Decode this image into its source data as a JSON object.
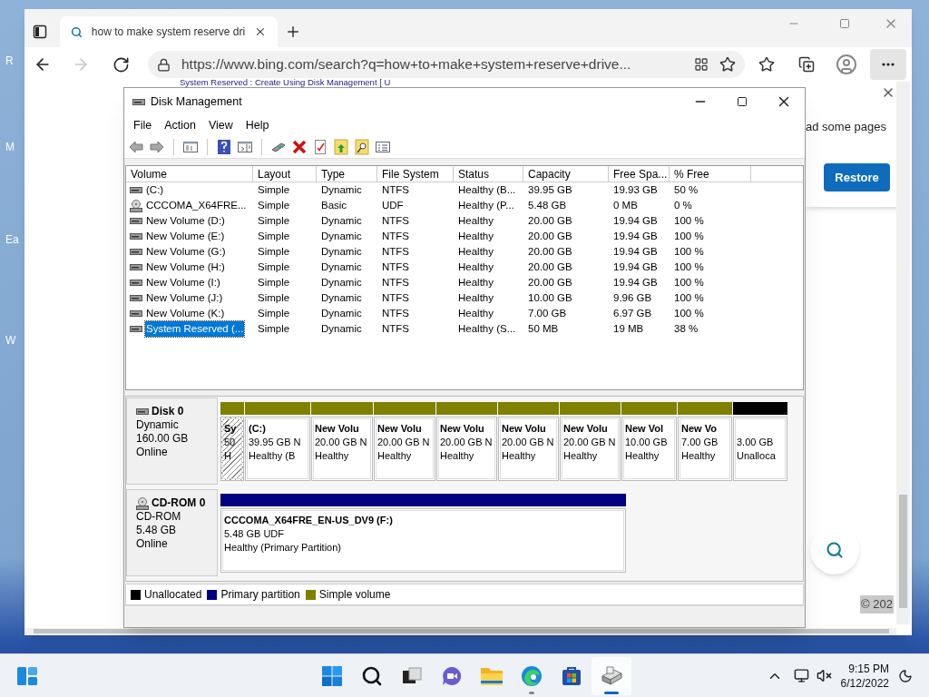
{
  "desktop": {
    "icon_labels": [
      "R",
      "M",
      "Ea",
      "W"
    ]
  },
  "browser": {
    "tab_title": "how to make system reserve dri",
    "address": "https://www.bing.com/search?q=how+to+make+system+reserve+drive...",
    "forward_disabled": true,
    "page": {
      "heading": "System Reserved : Create Using Disk Management [ U",
      "notice": "ad some pages",
      "restore_button": "Restore",
      "footer": "© 202"
    }
  },
  "disk_management": {
    "title": "Disk Management",
    "menu": [
      "File",
      "Action",
      "View",
      "Help"
    ],
    "toolbar": [
      {
        "kind": "back"
      },
      {
        "kind": "forward"
      },
      {
        "kind": "separator"
      },
      {
        "kind": "console_tree"
      },
      {
        "kind": "separator"
      },
      {
        "kind": "help"
      },
      {
        "kind": "action_pane"
      },
      {
        "kind": "separator"
      },
      {
        "kind": "connect"
      },
      {
        "kind": "delete"
      },
      {
        "kind": "check"
      },
      {
        "kind": "folder_up"
      },
      {
        "kind": "search_folder"
      },
      {
        "kind": "properties"
      }
    ],
    "columns": [
      "Volume",
      "Layout",
      "Type",
      "File System",
      "Status",
      "Capacity",
      "Free Spa...",
      "% Free"
    ],
    "rows": [
      {
        "kind": "disk",
        "selected": false,
        "cells": [
          "(C:)",
          "Simple",
          "Dynamic",
          "NTFS",
          "Healthy (B...",
          "39.95 GB",
          "19.93 GB",
          "50 %"
        ]
      },
      {
        "kind": "cdrom",
        "selected": false,
        "cells": [
          "CCCOMA_X64FRE...",
          "Simple",
          "Basic",
          "UDF",
          "Healthy (P...",
          "5.48 GB",
          "0 MB",
          "0 %"
        ]
      },
      {
        "kind": "disk",
        "selected": false,
        "cells": [
          "New Volume (D:)",
          "Simple",
          "Dynamic",
          "NTFS",
          "Healthy",
          "20.00 GB",
          "19.94 GB",
          "100 %"
        ]
      },
      {
        "kind": "disk",
        "selected": false,
        "cells": [
          "New Volume (E:)",
          "Simple",
          "Dynamic",
          "NTFS",
          "Healthy",
          "20.00 GB",
          "19.94 GB",
          "100 %"
        ]
      },
      {
        "kind": "disk",
        "selected": false,
        "cells": [
          "New Volume (G:)",
          "Simple",
          "Dynamic",
          "NTFS",
          "Healthy",
          "20.00 GB",
          "19.94 GB",
          "100 %"
        ]
      },
      {
        "kind": "disk",
        "selected": false,
        "cells": [
          "New Volume (H:)",
          "Simple",
          "Dynamic",
          "NTFS",
          "Healthy",
          "20.00 GB",
          "19.94 GB",
          "100 %"
        ]
      },
      {
        "kind": "disk",
        "selected": false,
        "cells": [
          "New Volume (I:)",
          "Simple",
          "Dynamic",
          "NTFS",
          "Healthy",
          "20.00 GB",
          "19.94 GB",
          "100 %"
        ]
      },
      {
        "kind": "disk",
        "selected": false,
        "cells": [
          "New Volume (J:)",
          "Simple",
          "Dynamic",
          "NTFS",
          "Healthy",
          "10.00 GB",
          "9.96 GB",
          "100 %"
        ]
      },
      {
        "kind": "disk",
        "selected": false,
        "cells": [
          "New Volume (K:)",
          "Simple",
          "Dynamic",
          "NTFS",
          "Healthy",
          "7.00 GB",
          "6.97 GB",
          "100 %"
        ]
      },
      {
        "kind": "disk",
        "selected": true,
        "cells": [
          "System Reserved (...",
          "Simple",
          "Dynamic",
          "NTFS",
          "Healthy (S...",
          "50 MB",
          "19 MB",
          "38 %"
        ]
      }
    ],
    "disks": [
      {
        "kind": "disk",
        "name": "Disk 0",
        "lines": [
          "Dynamic",
          "160.00 GB",
          "Online"
        ],
        "partitions": [
          {
            "name": "Sy",
            "size": "50",
            "status": "H",
            "color": "#808000",
            "selected": true
          },
          {
            "name": "(C:)",
            "size": "39.95 GB N",
            "status": "Healthy (B",
            "color": "#808000",
            "selected": false
          },
          {
            "name": "New Volu",
            "size": "20.00 GB N",
            "status": "Healthy",
            "color": "#808000",
            "selected": false
          },
          {
            "name": "New Volu",
            "size": "20.00 GB N",
            "status": "Healthy",
            "color": "#808000",
            "selected": false
          },
          {
            "name": "New Volu",
            "size": "20.00 GB N",
            "status": "Healthy",
            "color": "#808000",
            "selected": false
          },
          {
            "name": "New Volu",
            "size": "20.00 GB N",
            "status": "Healthy",
            "color": "#808000",
            "selected": false
          },
          {
            "name": "New Volu",
            "size": "20.00 GB N",
            "status": "Healthy",
            "color": "#808000",
            "selected": false
          },
          {
            "name": "New Vol",
            "size": "10.00 GB",
            "status": "Healthy",
            "color": "#808000",
            "selected": false
          },
          {
            "name": "New Vo",
            "size": "7.00 GB",
            "status": "Healthy",
            "color": "#808000",
            "selected": false
          },
          {
            "size": "3.00 GB",
            "status": "Unalloca",
            "color": "#000000",
            "selected": false
          }
        ]
      },
      {
        "kind": "cdrom",
        "name": "CD-ROM 0",
        "lines": [
          "CD-ROM",
          "5.48 GB",
          "Online"
        ],
        "partitions": [
          {
            "name": "CCCOMA_X64FRE_EN-US_DV9  (F:)",
            "size": "5.48 GB UDF",
            "status": "Healthy (Primary Partition)",
            "color": "#000080",
            "selected": false
          }
        ]
      }
    ],
    "legend": [
      {
        "label": "Unallocated",
        "color": "#000000"
      },
      {
        "label": "Primary partition",
        "color": "#000080"
      },
      {
        "label": "Simple volume",
        "color": "#808000"
      }
    ]
  },
  "taskbar": {
    "apps": [
      {
        "kind": "start",
        "open": false,
        "selected": false
      },
      {
        "kind": "search",
        "open": false,
        "selected": false
      },
      {
        "kind": "task_view",
        "open": false,
        "selected": false
      },
      {
        "kind": "chat",
        "open": false,
        "selected": false
      },
      {
        "kind": "explorer",
        "open": false,
        "selected": false
      },
      {
        "kind": "edge",
        "open": true,
        "selected": false
      },
      {
        "kind": "store",
        "open": false,
        "selected": false
      },
      {
        "kind": "disk_management",
        "open": true,
        "selected": true
      }
    ],
    "time": "9:15 PM",
    "date": "6/12/2022"
  }
}
